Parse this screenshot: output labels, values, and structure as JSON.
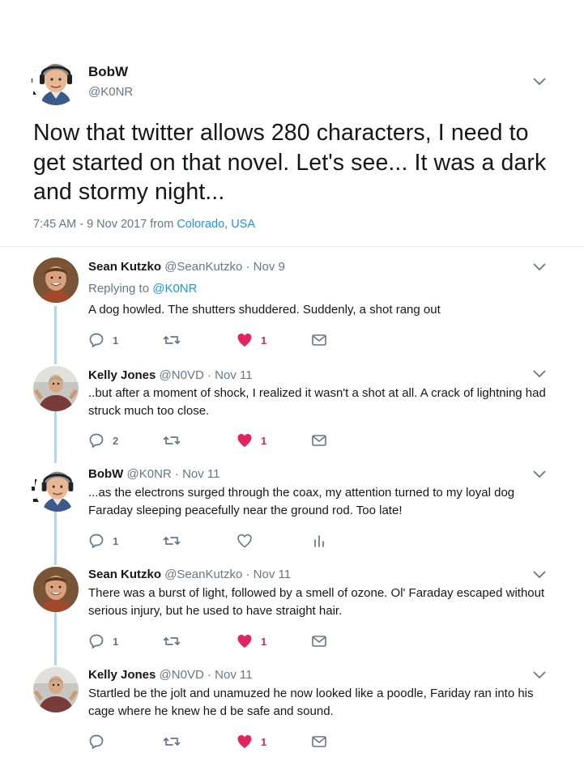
{
  "main_tweet": {
    "name": "BobW",
    "handle": "@K0NR",
    "text": "Now that twitter allows 280 characters, I need to get started on that novel. Let's see... It was a dark and stormy night...",
    "time": "7:45 AM - 9 Nov 2017 from ",
    "location": "Colorado, USA"
  },
  "replies": [
    {
      "name": "Sean Kutzko",
      "handle": "@SeanKutzko",
      "dot": "·",
      "date": "Nov 9",
      "replying_prefix": "Replying to ",
      "replying_to": "@K0NR",
      "text": "A dog howled. The shutters shuddered. Suddenly, a shot rang out",
      "reply_count": "1",
      "retweet_count": "",
      "like_count": "1",
      "liked": true,
      "avatar": "person-avatar"
    },
    {
      "name": "Kelly Jones",
      "handle": "@N0VD",
      "dot": "·",
      "date": "Nov 11",
      "text": "..but after a moment of shock, I realized it wasn't a shot at all. A crack of lightning had struck much too close.",
      "reply_count": "2",
      "retweet_count": "",
      "like_count": "1",
      "liked": true,
      "avatar": "person-avatar"
    },
    {
      "name": "BobW",
      "handle": "@K0NR",
      "dot": "·",
      "date": "Nov 11",
      "text": "...as the electrons surged through the coax, my attention turned to my loyal dog Faraday sleeping peacefully near the ground rod. Too late!",
      "reply_count": "1",
      "retweet_count": "",
      "like_count": "",
      "liked": false,
      "avatar": "cartoon-avatar"
    },
    {
      "name": "Sean Kutzko",
      "handle": "@SeanKutzko",
      "dot": "·",
      "date": "Nov 11",
      "text": "There was a burst of light, followed by a smell of ozone. Ol' Faraday escaped without serious injury, but he used to have straight hair.",
      "reply_count": "1",
      "retweet_count": "",
      "like_count": "1",
      "liked": true,
      "avatar": "person-avatar"
    },
    {
      "name": "Kelly Jones",
      "handle": "@N0VD",
      "dot": "·",
      "date": "Nov 11",
      "text": "Startled be the jolt and unamuzed he now looked like a poodle, Fariday ran into his cage where he knew he d be safe and sound.",
      "reply_count": "",
      "retweet_count": "",
      "like_count": "1",
      "liked": true,
      "avatar": "person-avatar"
    }
  ],
  "colors": {
    "link": "#1b95e0",
    "secondary": "#657786",
    "like": "#e0245e",
    "thread": "#aed6f6"
  }
}
